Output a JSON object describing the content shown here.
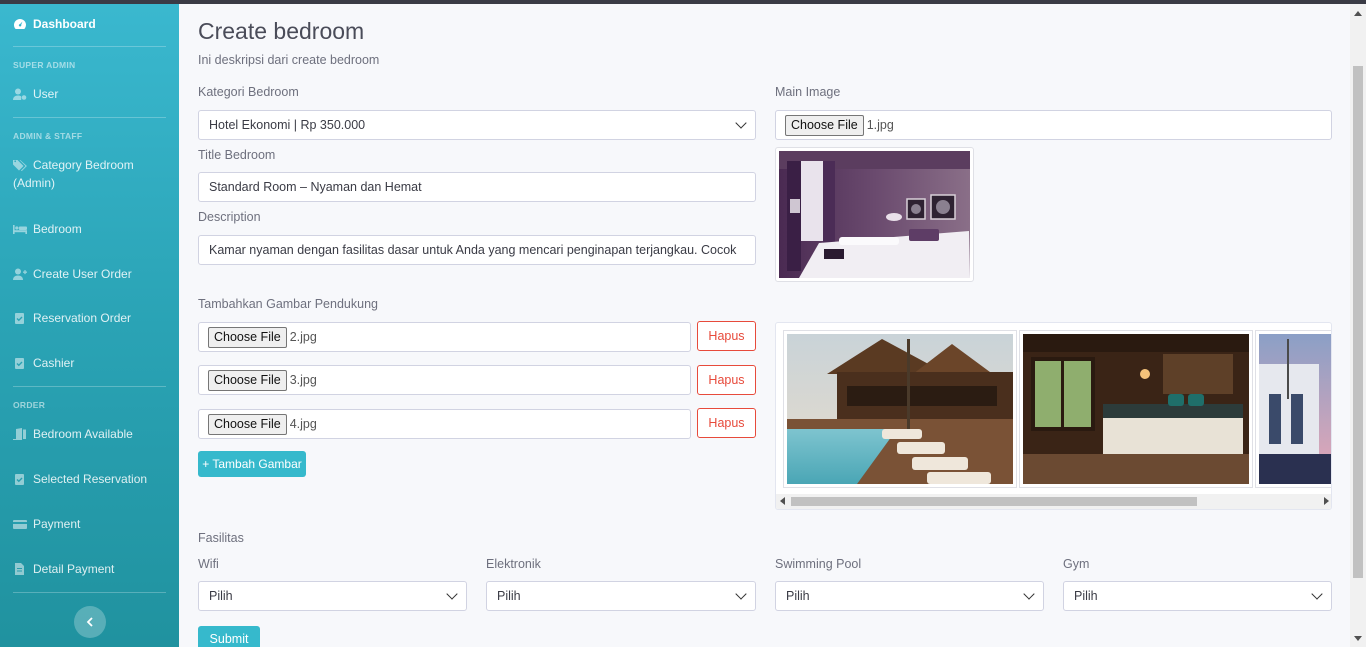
{
  "sidebar": {
    "dashboard": "Dashboard",
    "heading_super_admin": "SUPER ADMIN",
    "user": "User",
    "heading_admin_staff": "ADMIN & STAFF",
    "category_bedroom": "Category Bedroom",
    "category_bedroom_sub": "(Admin)",
    "bedroom": "Bedroom",
    "create_user_order": "Create User Order",
    "reservation_order": "Reservation Order",
    "cashier": "Cashier",
    "heading_order": "ORDER",
    "bedroom_available": "Bedroom Available",
    "selected_reservation": "Selected Reservation",
    "payment": "Payment",
    "detail_payment": "Detail Payment"
  },
  "page": {
    "title": "Create bedroom",
    "description": "Ini deskripsi dari create bedroom"
  },
  "form": {
    "kategori_label": "Kategori Bedroom",
    "kategori_value": "Hotel Ekonomi | Rp 350.000",
    "title_label": "Title Bedroom",
    "title_value": "Standard Room – Nyaman dan Hemat",
    "description_label": "Description",
    "description_value": "Kamar nyaman dengan fasilitas dasar untuk Anda yang mencari penginapan terjangkau. Cocok",
    "main_image_label": "Main Image",
    "main_image_file": "1.jpg",
    "choose_file": "Choose File",
    "pendukung_label": "Tambahkan Gambar Pendukung",
    "pendukung_files": [
      "2.jpg",
      "3.jpg",
      "4.jpg"
    ],
    "hapus_label": "Hapus",
    "tambah_gambar": "+ Tambah Gambar",
    "fasilitas_label": "Fasilitas",
    "fasilitas": [
      {
        "label": "Wifi",
        "value": "Pilih"
      },
      {
        "label": "Elektronik",
        "value": "Pilih"
      },
      {
        "label": "Swimming Pool",
        "value": "Pilih"
      },
      {
        "label": "Gym",
        "value": "Pilih"
      }
    ],
    "submit": "Submit"
  },
  "colors": {
    "primary": "#36b9cc",
    "danger": "#e74a3b",
    "sidebar_top": "#3ab8cf",
    "sidebar_bottom": "#20929f"
  }
}
